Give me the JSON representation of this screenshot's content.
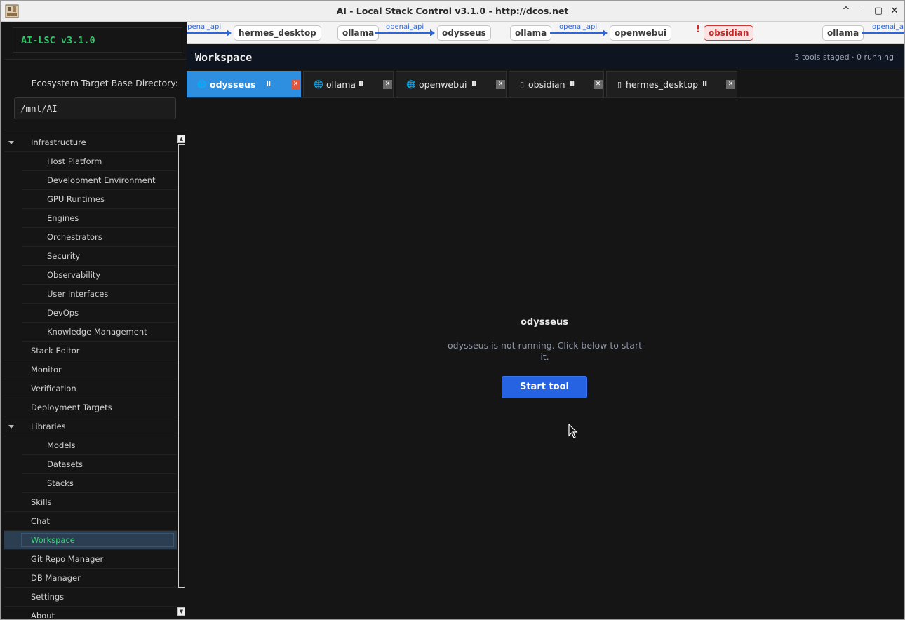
{
  "window": {
    "title": "AI - Local Stack Control v3.1.0 - http://dcos.net",
    "controls": {
      "chevron": "^",
      "minimize": "–",
      "maximize": "▢",
      "close": "✕"
    }
  },
  "sidebar": {
    "brand": "AI-LSC v3.1.0",
    "base_dir_label": "Ecosystem Target Base Directory:",
    "base_dir_value": "/mnt/AI",
    "items": [
      {
        "label": "Infrastructure",
        "level": 0,
        "expanded": true
      },
      {
        "label": "Host Platform",
        "level": 1
      },
      {
        "label": "Development Environment",
        "level": 1
      },
      {
        "label": "GPU Runtimes",
        "level": 1
      },
      {
        "label": "Engines",
        "level": 1
      },
      {
        "label": "Orchestrators",
        "level": 1
      },
      {
        "label": "Security",
        "level": 1
      },
      {
        "label": "Observability",
        "level": 1
      },
      {
        "label": "User Interfaces",
        "level": 1
      },
      {
        "label": "DevOps",
        "level": 1
      },
      {
        "label": "Knowledge Management",
        "level": 1
      },
      {
        "label": "Stack Editor",
        "level": 0
      },
      {
        "label": "Monitor",
        "level": 0
      },
      {
        "label": "Verification",
        "level": 0
      },
      {
        "label": "Deployment Targets",
        "level": 0
      },
      {
        "label": "Libraries",
        "level": 0,
        "expanded": true
      },
      {
        "label": "Models",
        "level": 1
      },
      {
        "label": "Datasets",
        "level": 1
      },
      {
        "label": "Stacks",
        "level": 1
      },
      {
        "label": "Skills",
        "level": 0
      },
      {
        "label": "Chat",
        "level": 0
      },
      {
        "label": "Workspace",
        "level": 0,
        "selected": true
      },
      {
        "label": "Git Repo Manager",
        "level": 0
      },
      {
        "label": "DB Manager",
        "level": 0
      },
      {
        "label": "Settings",
        "level": 0
      },
      {
        "label": "About",
        "level": 0
      }
    ]
  },
  "pipeline": {
    "nodes": [
      "hermes_desktop",
      "ollama",
      "odysseus",
      "ollama",
      "openwebui",
      "obsidian",
      "ollama"
    ],
    "edge_label": "openai_api",
    "alert_mark": "!"
  },
  "workspace": {
    "title": "Workspace",
    "status": "5 tools staged · 0 running",
    "tabs": [
      {
        "label": "odysseus",
        "icon": "globe-icon",
        "active": true
      },
      {
        "label": "ollama",
        "icon": "globe-icon"
      },
      {
        "label": "openwebui",
        "icon": "globe-icon"
      },
      {
        "label": "obsidian",
        "icon": "device-icon"
      },
      {
        "label": "hermes_desktop",
        "icon": "device-icon"
      }
    ],
    "pause_glyph": "II",
    "close_glyph": "✕",
    "empty_title": "odysseus",
    "empty_message": "odysseus is not running. Click below to start it.",
    "start_button": "Start tool"
  },
  "colors": {
    "accent_green": "#35c46a",
    "tab_active": "#2e8fe0",
    "button_blue": "#2563e3",
    "edge_blue": "#2c66d8",
    "alert_red": "#c52626"
  }
}
